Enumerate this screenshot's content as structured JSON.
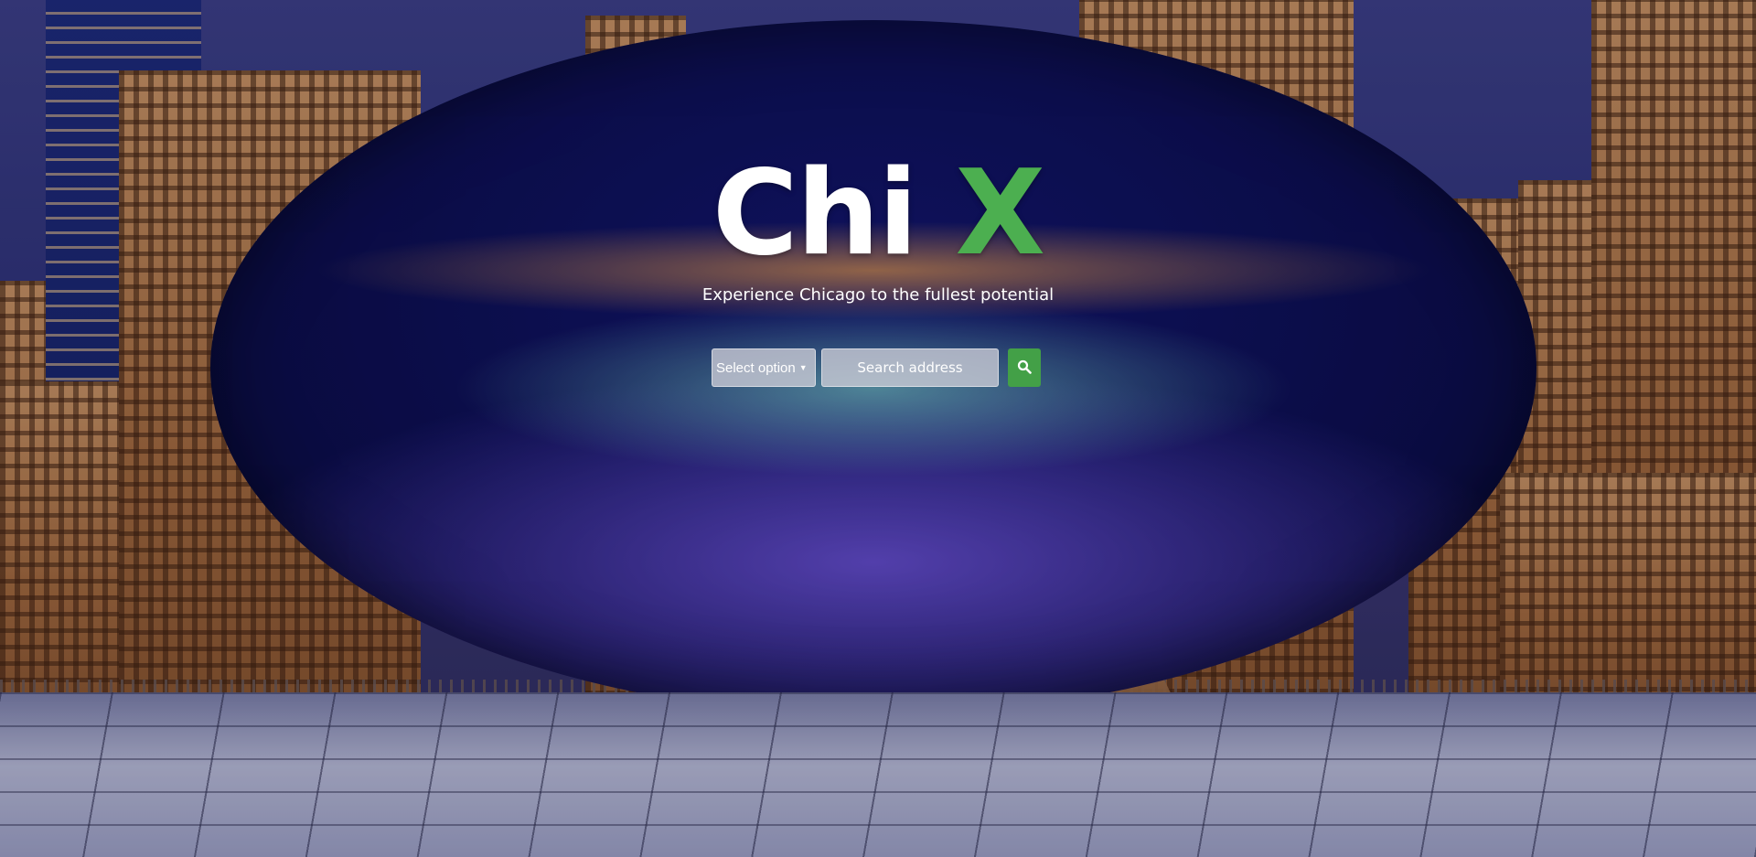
{
  "brand": {
    "name": "Chi",
    "accent": "X",
    "accent_color": "#4caf50"
  },
  "tagline": "Experience Chicago to the fullest potential",
  "search": {
    "select_label": "Select option",
    "address_placeholder": "Search address",
    "submit_icon": "search-icon"
  },
  "background": {
    "subject": "cloud-gate-photo"
  }
}
